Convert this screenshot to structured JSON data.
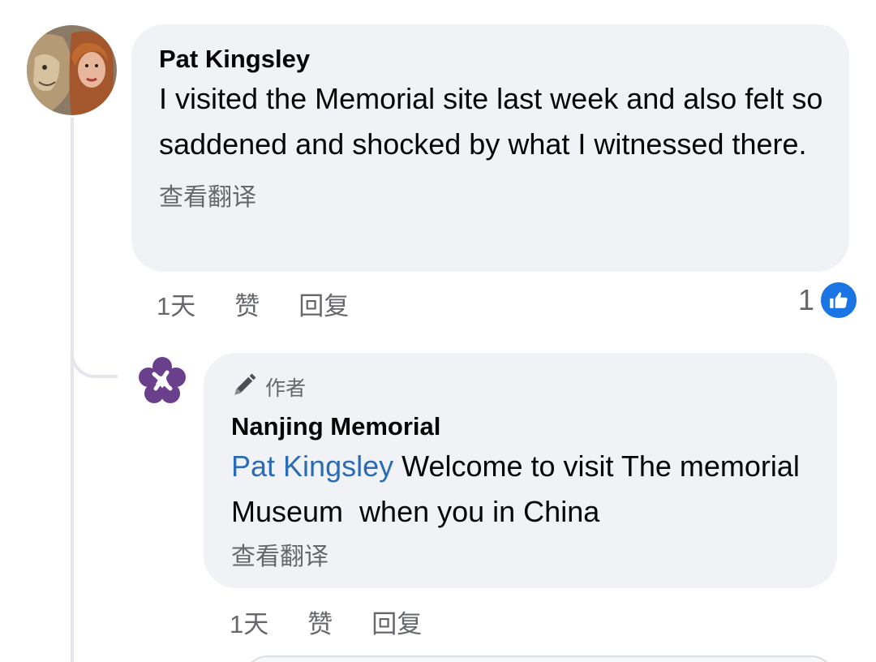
{
  "comments": [
    {
      "author": "Pat Kingsley",
      "text": "I visited the Memorial site last week and also felt so saddened and shocked by what I witnessed there.",
      "see_translation": "查看翻译",
      "actions": {
        "time": "1天",
        "like": "赞",
        "reply": "回复"
      },
      "reactions": {
        "count": "1",
        "icon": "like-icon"
      }
    }
  ],
  "reply": {
    "badge_icon": "pencil-icon",
    "badge": "作者",
    "author": "Nanjing Memorial",
    "mention": "Pat Kingsley",
    "text": " Welcome to visit The memorial Museum  when you in China",
    "see_translation": "查看翻译",
    "actions": {
      "time": "1天",
      "like": "赞",
      "reply": "回复"
    }
  },
  "colors": {
    "bubble": "#f0f2f5",
    "meta_text": "#65676b",
    "mention": "#2a6bb5",
    "like_blue": "#1b74e4",
    "nanjing_logo_purple": "#6a3f8c"
  }
}
